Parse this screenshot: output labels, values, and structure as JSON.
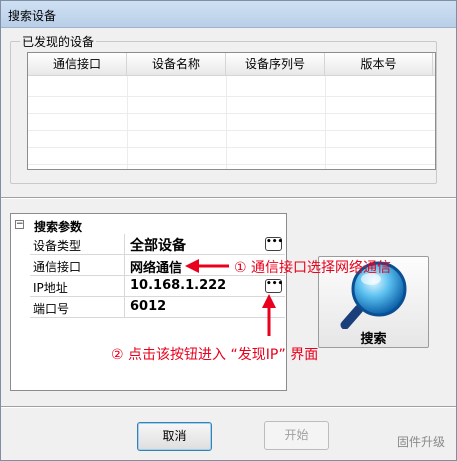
{
  "window": {
    "title": "搜索设备"
  },
  "discovered": {
    "label": "已发现的设备",
    "columns": [
      "通信接口",
      "设备名称",
      "设备序列号",
      "版本号"
    ]
  },
  "search_params": {
    "title": "搜索参数",
    "collapse_glyph": "⊟",
    "rows": [
      {
        "name": "设备类型",
        "value": "全部设备"
      },
      {
        "name": "通信接口",
        "value": "网络通信"
      },
      {
        "name": "IP地址",
        "value": "10.168.1.222"
      },
      {
        "name": "端口号",
        "value": "6012"
      }
    ],
    "ellipsis": "…"
  },
  "search_button": {
    "label": "搜索",
    "icon": "magnifier-icon"
  },
  "annotations": {
    "note1": "① 通信接口选择网络通信",
    "note2": "② 点击该按钮进入 “发现IP” 界面",
    "color": "#e8001c"
  },
  "footer": {
    "cancel": "取消",
    "start": "开始",
    "firmware": "固件升级"
  }
}
